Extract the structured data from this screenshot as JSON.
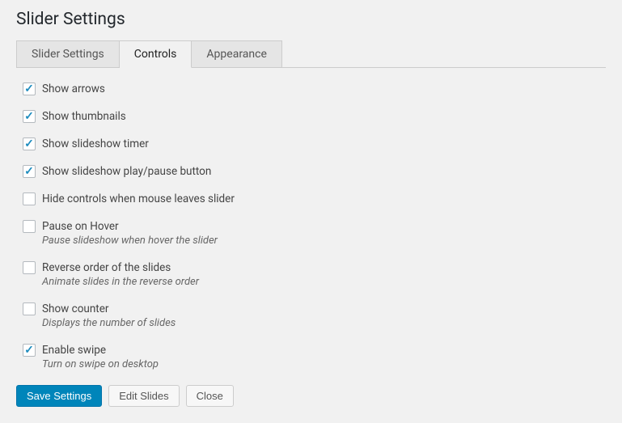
{
  "title": "Slider Settings",
  "tabs": [
    {
      "label": "Slider Settings",
      "active": false
    },
    {
      "label": "Controls",
      "active": true
    },
    {
      "label": "Appearance",
      "active": false
    }
  ],
  "options": [
    {
      "key": "show-arrows",
      "label": "Show arrows",
      "checked": true,
      "desc": ""
    },
    {
      "key": "show-thumbnails",
      "label": "Show thumbnails",
      "checked": true,
      "desc": ""
    },
    {
      "key": "show-slideshow-timer",
      "label": "Show slideshow timer",
      "checked": true,
      "desc": ""
    },
    {
      "key": "show-play-pause",
      "label": "Show slideshow play/pause button",
      "checked": true,
      "desc": ""
    },
    {
      "key": "hide-controls-on-leave",
      "label": "Hide controls when mouse leaves slider",
      "checked": false,
      "desc": ""
    },
    {
      "key": "pause-on-hover",
      "label": "Pause on Hover",
      "checked": false,
      "desc": "Pause slideshow when hover the slider"
    },
    {
      "key": "reverse-order",
      "label": "Reverse order of the slides",
      "checked": false,
      "desc": "Animate slides in the reverse order"
    },
    {
      "key": "show-counter",
      "label": "Show counter",
      "checked": false,
      "desc": "Displays the number of slides"
    },
    {
      "key": "enable-swipe",
      "label": "Enable swipe",
      "checked": true,
      "desc": "Turn on swipe on desktop"
    }
  ],
  "buttons": {
    "save": "Save Settings",
    "edit": "Edit Slides",
    "close": "Close"
  }
}
